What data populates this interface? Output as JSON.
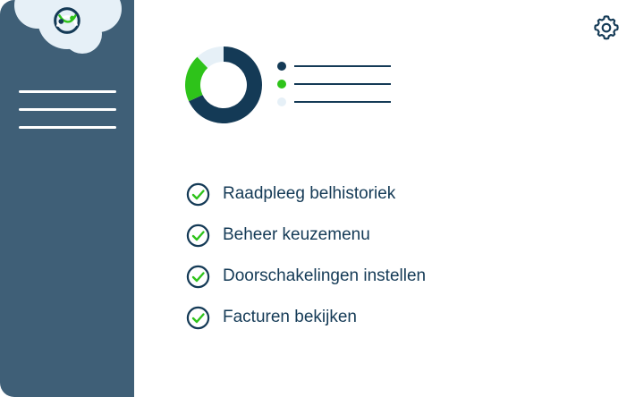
{
  "colors": {
    "sidebar": "#3f5f77",
    "navy": "#143a56",
    "green": "#2ec31a",
    "light": "#e6f0f7",
    "white": "#ffffff"
  },
  "chart_data": {
    "type": "pie",
    "title": "",
    "slices": [
      {
        "value": 68,
        "color": "#143a56"
      },
      {
        "value": 20,
        "color": "#2ec31a"
      },
      {
        "value": 12,
        "color": "#e6f0f7"
      }
    ],
    "legend_placement": "right"
  },
  "features": [
    {
      "label": "Raadpleeg belhistoriek"
    },
    {
      "label": "Beheer keuzemenu"
    },
    {
      "label": "Doorschakelingen instellen"
    },
    {
      "label": "Facturen bekijken"
    }
  ],
  "icons": {
    "settings": "gear-icon",
    "check": "check-circle-icon",
    "logo": "logo-icon",
    "menu": "menu-icon"
  }
}
